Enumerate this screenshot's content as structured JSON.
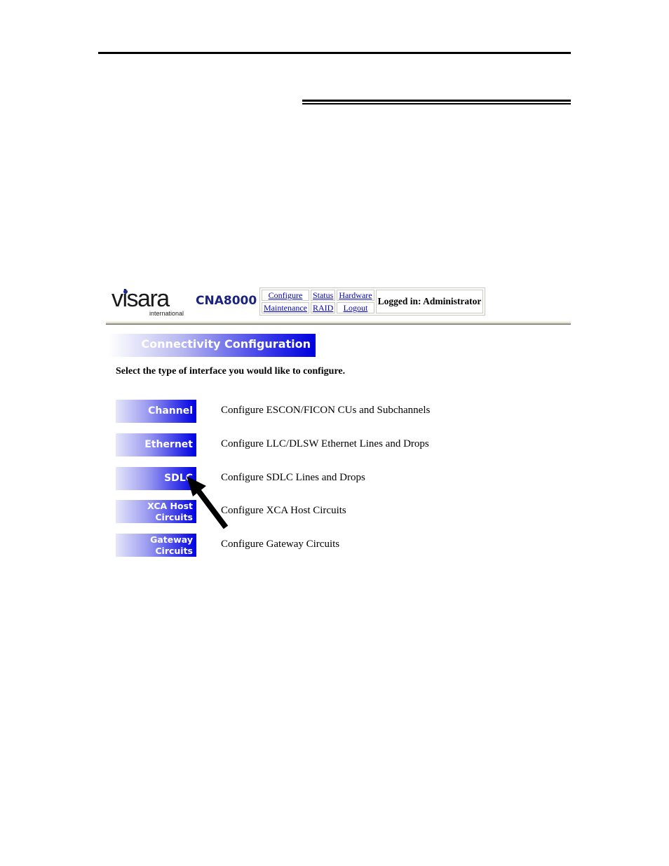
{
  "header": {
    "logo_text": "visara",
    "logo_subtext": "international",
    "product": "CNA8000"
  },
  "nav": {
    "links": [
      {
        "label": "Configure"
      },
      {
        "label": "Status"
      },
      {
        "label": "Hardware"
      },
      {
        "label": "Maintenance"
      },
      {
        "label": "RAID"
      },
      {
        "label": "Logout"
      }
    ],
    "login_status": "Logged in: Administrator"
  },
  "page": {
    "title": "Connectivity Configuration",
    "prompt": "Select the type of interface you would like to configure."
  },
  "options": [
    {
      "label_lines": [
        "Channel"
      ],
      "description": "Configure ESCON/FICON CUs and Subchannels"
    },
    {
      "label_lines": [
        "Ethernet"
      ],
      "description": "Configure LLC/DLSW Ethernet Lines and Drops"
    },
    {
      "label_lines": [
        "SDLC"
      ],
      "description": "Configure SDLC Lines and Drops"
    },
    {
      "label_lines": [
        "XCA Host",
        "Circuits"
      ],
      "description": "Configure XCA Host Circuits"
    },
    {
      "label_lines": [
        "Gateway",
        "Circuits"
      ],
      "description": "Configure Gateway Circuits"
    }
  ],
  "annotation": {
    "type": "arrow-icon",
    "points_to": "SDLC"
  }
}
